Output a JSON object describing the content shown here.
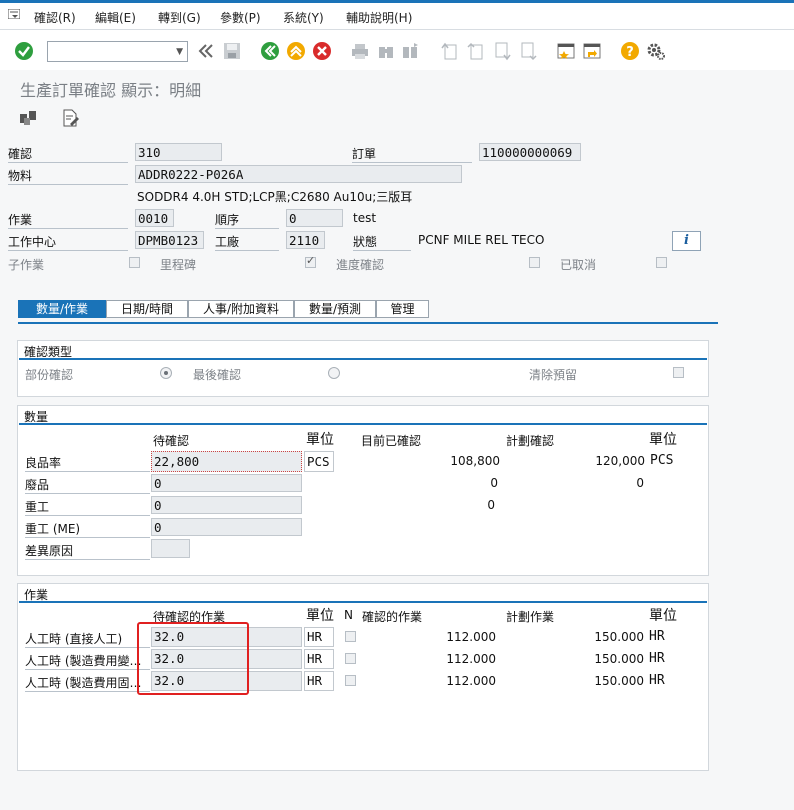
{
  "menu": {
    "items": [
      "確認(R)",
      "編輯(E)",
      "轉到(G)",
      "參數(P)",
      "系統(Y)",
      "輔助說明(H)"
    ]
  },
  "toolbar": {
    "command_value": "",
    "icons": [
      "enter-check-icon",
      "back-double-chevron-icon",
      "save-icon",
      "back-icon",
      "exit-icon",
      "cancel-icon",
      "print-icon",
      "find-icon",
      "find-next-icon",
      "first-page-icon",
      "previous-page-icon",
      "next-page-icon",
      "last-page-icon",
      "new-session-icon",
      "shortcut-icon",
      "help-icon",
      "customize-layout-icon"
    ]
  },
  "title": "生產訂單確認 顯示：明細",
  "header": {
    "confirmation_label": "確認",
    "confirmation_value": "310",
    "order_label": "訂單",
    "order_value": "110000000069",
    "material_label": "物料",
    "material_value": "ADDR0222-P026A",
    "material_desc": "SODDR4 4.0H STD;LCP黑;C2680 Au10u;三版耳",
    "operation_label": "作業",
    "operation_value": "0010",
    "sequence_label": "順序",
    "sequence_value": "0",
    "operation_text": "test",
    "work_center_label": "工作中心",
    "work_center_value": "DPMB0123",
    "plant_label": "工廠",
    "plant_value": "2110",
    "status_label": "狀態",
    "status_value": "PCNF MILE REL  TECO",
    "sub_operation_label": "子作業",
    "milestone_label": "里程碑",
    "progress_confirm_label": "進度確認",
    "cancelled_label": "已取消"
  },
  "tabs": [
    "數量/作業",
    "日期/時間",
    "人事/附加資料",
    "數量/預測",
    "管理"
  ],
  "confirmation_type": {
    "title": "確認類型",
    "partial_label": "部份確認",
    "final_label": "最後確認",
    "clear_reservation_label": "清除預留"
  },
  "quantities": {
    "title": "數量",
    "col_to_confirm": "待確認",
    "col_unit": "單位",
    "col_confirmed_so_far": "目前已確認",
    "col_planned": "計劃確認",
    "col_unit2": "單位",
    "rows": [
      {
        "label": "良品率",
        "to_confirm": "22,800",
        "unit": "PCS",
        "confirmed": "108,800",
        "planned": "120,000",
        "unit2": "PCS"
      },
      {
        "label": "廢品",
        "to_confirm": "0",
        "unit": "",
        "confirmed": "0",
        "planned": "0",
        "unit2": ""
      },
      {
        "label": "重工",
        "to_confirm": "0",
        "unit": "",
        "confirmed": "0",
        "planned": "",
        "unit2": ""
      },
      {
        "label": "重工 (ME)",
        "to_confirm": "0",
        "unit": "",
        "confirmed": "",
        "planned": "",
        "unit2": ""
      },
      {
        "label": "差異原因",
        "to_confirm": "",
        "unit": "",
        "confirmed": "",
        "planned": "",
        "unit2": ""
      }
    ]
  },
  "activities": {
    "title": "作業",
    "col_to_confirm": "待確認的作業",
    "col_unit": "單位",
    "col_n": "N",
    "col_confirmed": "確認的作業",
    "col_planned": "計劃作業",
    "col_unit2": "單位",
    "rows": [
      {
        "label": "人工時 (直接人工)",
        "to_confirm": "32.0",
        "unit": "HR",
        "confirmed": "112.000",
        "planned": "150.000",
        "unit2": "HR"
      },
      {
        "label": "人工時 (製造費用變…",
        "to_confirm": "32.0",
        "unit": "HR",
        "confirmed": "112.000",
        "planned": "150.000",
        "unit2": "HR"
      },
      {
        "label": "人工時 (製造費用固…",
        "to_confirm": "32.0",
        "unit": "HR",
        "confirmed": "112.000",
        "planned": "150.000",
        "unit2": "HR"
      }
    ]
  },
  "colors": {
    "accent": "#1a73b8",
    "highlight": "#e02020",
    "ok_green": "#2e9e3e",
    "warn_yellow": "#f2a900",
    "cancel_red": "#d92b2b"
  }
}
